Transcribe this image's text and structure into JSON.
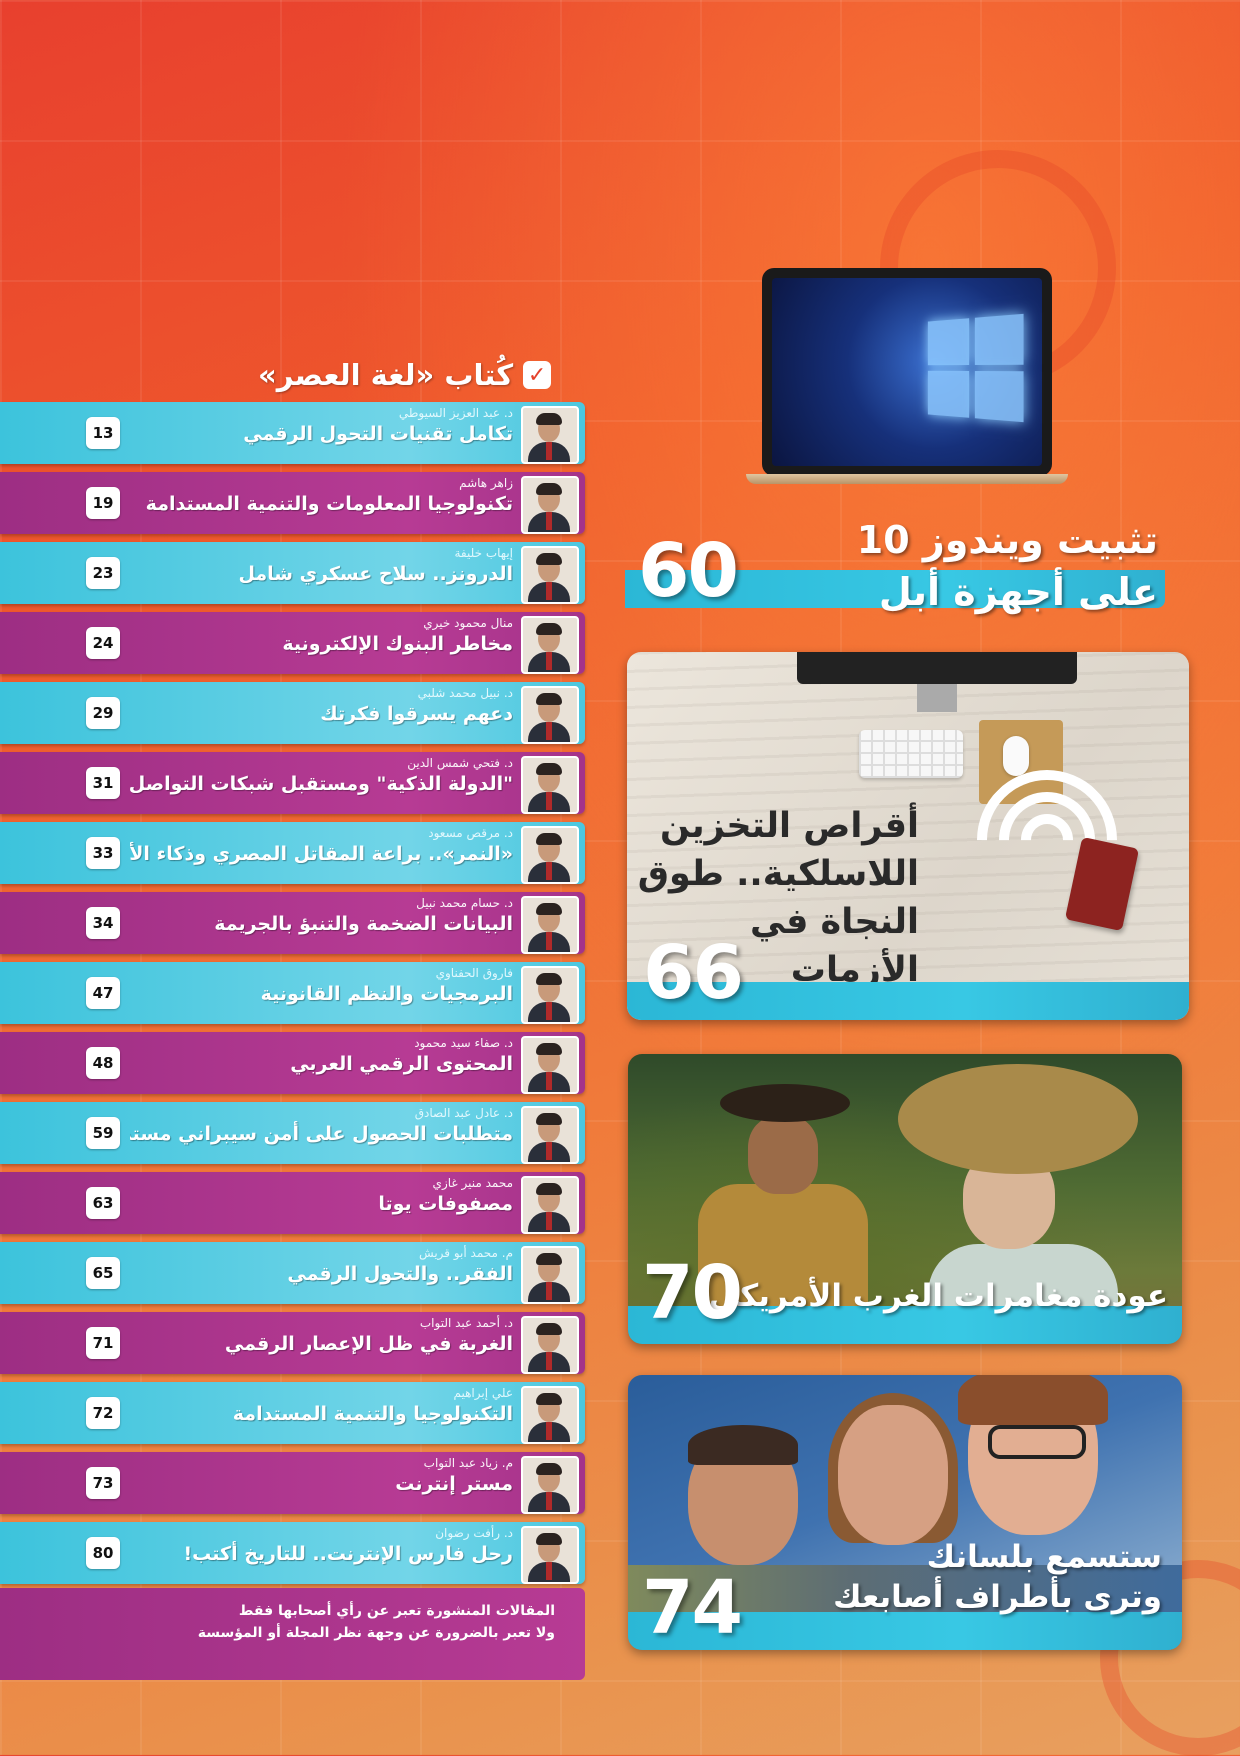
{
  "toc": {
    "header": {
      "title": "كُتاب «لغة العصر»",
      "check_icon": "check-icon"
    },
    "entries": [
      {
        "page": "13",
        "author": "د. عبد العزيز السيوطي",
        "title": "تكامل تقنيات التحول الرقمي",
        "color": "cyan"
      },
      {
        "page": "19",
        "author": "زاهر هاشم",
        "title": "تكنولوجيا المعلومات والتنمية المستدامة",
        "color": "purple"
      },
      {
        "page": "23",
        "author": "إيهاب خليفة",
        "title": "الدرونز.. سلاح عسكري شامل",
        "color": "cyan"
      },
      {
        "page": "24",
        "author": "منال محمود خيري",
        "title": "مخاطر البنوك الإلكترونية",
        "color": "purple"
      },
      {
        "page": "29",
        "author": "د. نبيل محمد شلبي",
        "title": "دعهم يسرقوا فكرتك",
        "color": "cyan"
      },
      {
        "page": "31",
        "author": "د. فتحي شمس الدين",
        "title": "\"الدولة الذكية\" ومستقبل شبكات التواصل",
        "color": "purple"
      },
      {
        "page": "33",
        "author": "د. مرقص مسعود",
        "title": "«النمر».. براعة المقاتل المصري وذكاء الأسلحة",
        "color": "cyan"
      },
      {
        "page": "34",
        "author": "د. حسام محمد نبيل",
        "title": "البيانات الضخمة والتنبؤ بالجريمة",
        "color": "purple"
      },
      {
        "page": "47",
        "author": "فاروق الحفناوي",
        "title": "البرمجيات والنظم القانونية",
        "color": "cyan"
      },
      {
        "page": "48",
        "author": "د. صفاء سيد محمود",
        "title": "المحتوى الرقمي العربي",
        "color": "purple"
      },
      {
        "page": "59",
        "author": "د. عادل عبد الصادق",
        "title": "متطلبات الحصول على أمن سيبراني مستدام",
        "color": "cyan"
      },
      {
        "page": "63",
        "author": "محمد منير غازي",
        "title": "مصفوفات يوتا",
        "color": "purple"
      },
      {
        "page": "65",
        "author": "م. محمد أبو قريش",
        "title": "الفقر.. والتحول الرقمي",
        "color": "cyan"
      },
      {
        "page": "71",
        "author": "د. أحمد عبد التواب",
        "title": "الغربة في ظل الإعصار الرقمي",
        "color": "purple"
      },
      {
        "page": "72",
        "author": "علي إبراهيم",
        "title": "التكنولوجيا والتنمية المستدامة",
        "color": "cyan"
      },
      {
        "page": "73",
        "author": "م. زياد عبد التواب",
        "title": "مستر إنترنت",
        "color": "purple"
      },
      {
        "page": "80",
        "author": "د. رأفت رضوان",
        "title": "رحل فارس الإنترنت.. للتاريخ أكتب!",
        "color": "cyan"
      }
    ],
    "disclaimer": {
      "line1": "المقالات المنشورة تعبر عن رأي أصحابها فقط",
      "line2": "ولا تعبر بالضرورة عن وجهة نظر المجلة أو المؤسسة"
    }
  },
  "features": {
    "windows": {
      "line1": "تثبيت ويندوز 10",
      "line2": "على أجهزة أبل",
      "page": "60",
      "icons": [
        "apple-logo-icon",
        "windows-logo-icon"
      ]
    },
    "storage": {
      "line1": "أقراص التخزين",
      "line2": "اللاسلكية.. طوق",
      "line3": "النجاة في الأزمات",
      "page": "66"
    },
    "western": {
      "title": "عودة مغامرات الغرب الأمريكي",
      "page": "70"
    },
    "tongue": {
      "line1": "ستسمع بلسانك",
      "line2": "وترى بأطراف أصابعك",
      "page": "74"
    }
  },
  "colors": {
    "background": "#ef5a2c",
    "cyan_band": "#3cc3dc",
    "purple_band": "#a4338a"
  }
}
